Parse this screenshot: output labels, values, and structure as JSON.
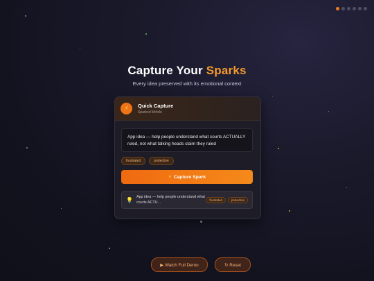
{
  "pagination": {
    "count": 6,
    "active_index": 0
  },
  "hero": {
    "title_part1": "Capture Your",
    "title_accent": "Sparks",
    "subtitle": "Every idea preserved with its emotional context"
  },
  "card": {
    "icon": "lightning-bolt-icon",
    "title": "Quick Capture",
    "subtitle": "Sparked Mobile",
    "idea_text": "App idea — help people understand what courts ACTUALLY ruled, not what talking heads claim they ruled",
    "tags": [
      "frustrated",
      "protective"
    ],
    "capture_button": {
      "icon": "⚡",
      "label": "Capture Spark"
    },
    "saved_item": {
      "icon": "lightbulb-icon",
      "text": "App idea — help people understand what courts ACTU...",
      "tags": [
        "frustrated",
        "protective"
      ]
    }
  },
  "footer": {
    "demo_button": "▶ Watch Full Demo",
    "reset_button": "↻ Reset"
  },
  "colors": {
    "accent": "#f07a1e",
    "highlight": "#f59a2c",
    "background": "#161622"
  }
}
